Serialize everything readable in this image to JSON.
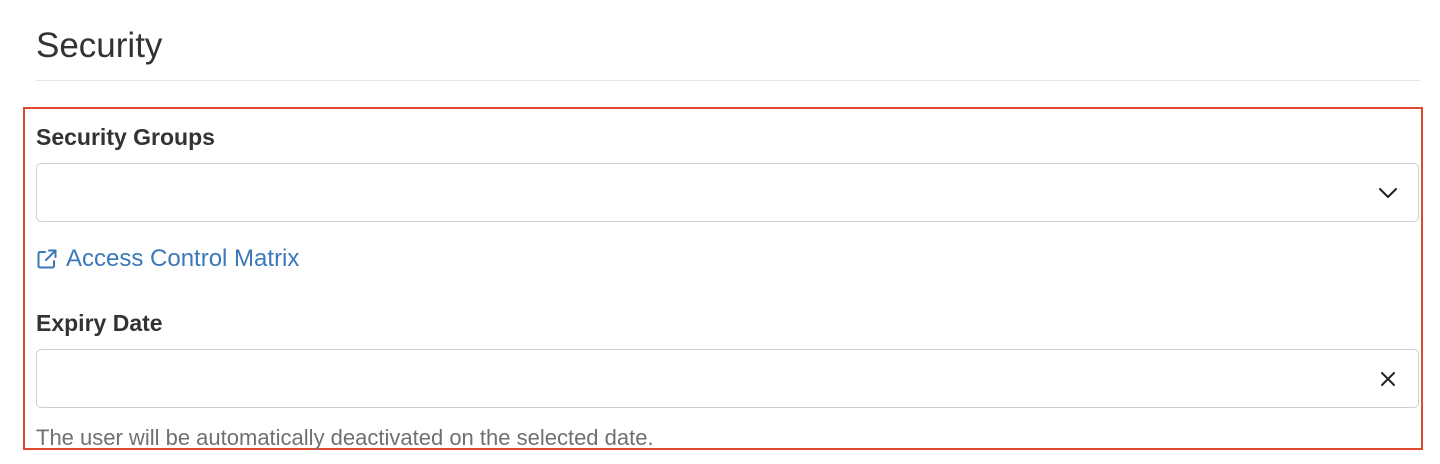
{
  "section": {
    "title": "Security"
  },
  "security_groups": {
    "label": "Security Groups",
    "selected_value": "",
    "icon": "chevron-down-icon"
  },
  "access_link": {
    "label": "Access Control Matrix",
    "icon": "external-link-icon"
  },
  "expiry_date": {
    "label": "Expiry Date",
    "value": "",
    "clear_icon": "close-icon",
    "help_text": "The user will be automatically deactivated on the selected date."
  },
  "colors": {
    "link": "#3b78b8",
    "highlight_border": "#e04a30",
    "text": "#333333",
    "help_text": "#707070",
    "input_border": "#cfcfcf"
  }
}
